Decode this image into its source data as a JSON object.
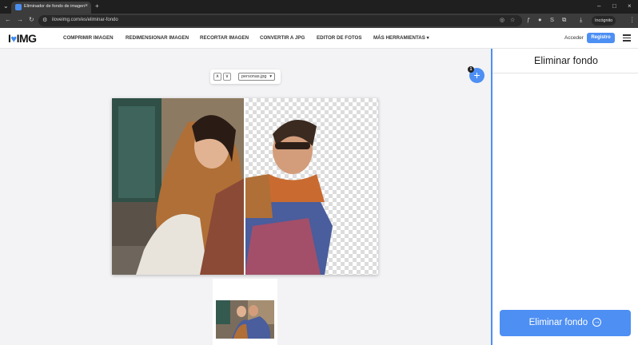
{
  "browser": {
    "tab_title": "Eliminador de fondo de imagen",
    "tab_close": "×",
    "new_tab": "+",
    "url": "iloveimg.com/es/eliminar-fondo",
    "incognito_label": "Incógnito"
  },
  "header": {
    "logo_i": "I",
    "logo_heart": "♥",
    "logo_img": "IMG",
    "nav": [
      "COMPRIMIR IMAGEN",
      "REDIMENSIONAR IMAGEN",
      "RECORTAR IMAGEN",
      "CONVERTIR A JPG",
      "EDITOR DE FOTOS",
      "MÁS HERRAMIENTAS ▾"
    ],
    "login": "Acceder",
    "signup": "Registro"
  },
  "workspace": {
    "file_name": "personas.jpg",
    "file_count": "1",
    "add_symbol": "+"
  },
  "panel": {
    "title": "Eliminar fondo",
    "action_label": "Eliminar fondo",
    "action_icon": "→"
  },
  "colors": {
    "accent": "#4d8ff3",
    "chrome_dark": "#1f1f1f",
    "chrome_toolbar": "#3c3c3c"
  }
}
